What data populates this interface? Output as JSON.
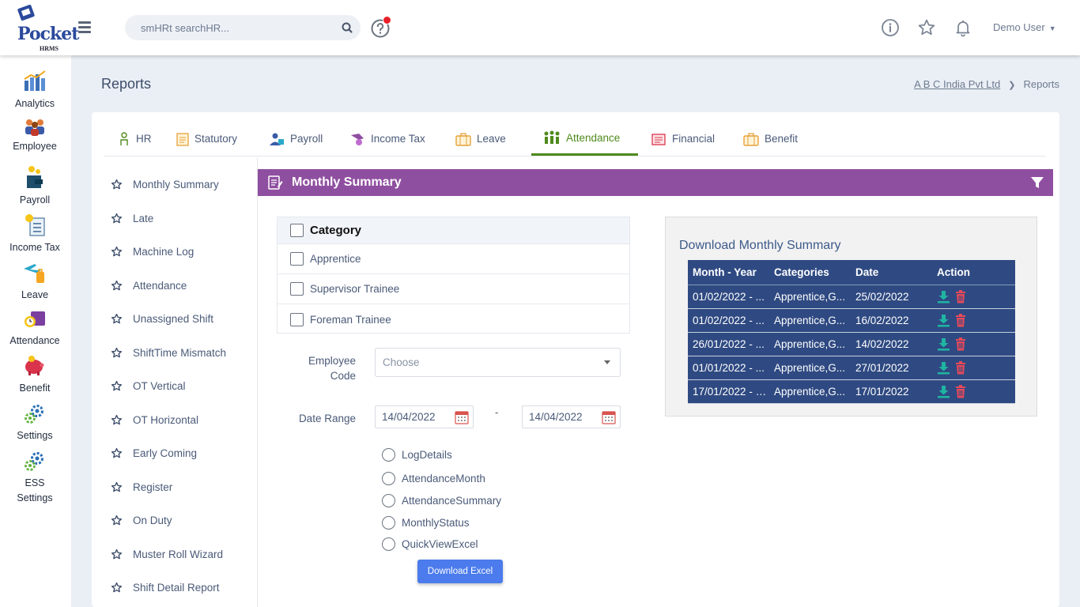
{
  "app": {
    "logo_text": "Pocket",
    "logo_sub": "HRMS"
  },
  "search": {
    "placeholder": "smHRt searchHR..."
  },
  "user": {
    "name": "Demo User"
  },
  "sidebar": {
    "items": [
      {
        "label": "Analytics",
        "icon": "analytics-icon"
      },
      {
        "label": "Employee",
        "icon": "employee-icon"
      },
      {
        "label": "Payroll",
        "icon": "payroll-icon"
      },
      {
        "label": "Income Tax",
        "icon": "income-tax-icon"
      },
      {
        "label": "Leave",
        "icon": "leave-icon"
      },
      {
        "label": "Attendance",
        "icon": "attendance-icon"
      },
      {
        "label": "Benefit",
        "icon": "benefit-icon"
      },
      {
        "label": "Settings",
        "icon": "settings-icon"
      },
      {
        "label": "ESS Settings",
        "icon": "ess-settings-icon"
      }
    ]
  },
  "page": {
    "title": "Reports",
    "breadcrumb": {
      "company": "A B C India Pvt Ltd",
      "current": "Reports"
    }
  },
  "tabs": [
    {
      "label": "HR",
      "icon": "hr-icon"
    },
    {
      "label": "Statutory",
      "icon": "statutory-icon"
    },
    {
      "label": "Payroll",
      "icon": "payroll-icon"
    },
    {
      "label": "Income Tax",
      "icon": "income-tax-icon"
    },
    {
      "label": "Leave",
      "icon": "leave-icon"
    },
    {
      "label": "Attendance",
      "icon": "attendance-icon",
      "active": true
    },
    {
      "label": "Financial",
      "icon": "financial-icon"
    },
    {
      "label": "Benefit",
      "icon": "benefit-icon"
    }
  ],
  "reports": [
    "Monthly Summary",
    "Late",
    "Machine Log",
    "Attendance",
    "Unassigned Shift",
    "ShiftTime Mismatch",
    "OT Vertical",
    "OT Horizontal",
    "Early Coming",
    "Register",
    "On Duty",
    "Muster Roll Wizard",
    "Shift Detail Report"
  ],
  "section": {
    "title": "Monthly Summary"
  },
  "category": {
    "title": "Category",
    "options": [
      "Apprentice",
      "Supervisor Trainee",
      "Foreman Trainee"
    ]
  },
  "form": {
    "employee_code_label": "Employee Code",
    "employee_code_placeholder": "Choose",
    "date_range_label": "Date Range",
    "date_from": "14/04/2022",
    "date_separator": "-",
    "date_to": "14/04/2022",
    "options": [
      "LogDetails",
      "AttendanceMonth",
      "AttendanceSummary",
      "MonthlyStatus",
      "QuickViewExcel"
    ],
    "download_label": "Download Excel"
  },
  "download_panel": {
    "title": "Download Monthly Summary",
    "columns": [
      "Month - Year",
      "Categories",
      "Date",
      "Action"
    ],
    "rows": [
      {
        "month_year": "01/02/2022 - ...",
        "categories": "Apprentice,G...",
        "date": "25/02/2022"
      },
      {
        "month_year": "01/02/2022 - ...",
        "categories": "Apprentice,G...",
        "date": "16/02/2022"
      },
      {
        "month_year": "26/01/2022 - ...",
        "categories": "Apprentice,G...",
        "date": "14/02/2022"
      },
      {
        "month_year": "01/01/2022 - ...",
        "categories": "Apprentice,G...",
        "date": "27/01/2022"
      },
      {
        "month_year": "17/01/2022 - 1...",
        "categories": "Apprentice,G...",
        "date": "17/01/2022"
      }
    ]
  },
  "colors": {
    "accent_purple": "#8f4fa0",
    "tab_active_green": "#4f8a1c",
    "table_navy": "#2f4a82",
    "button_blue": "#4b7bec",
    "download_teal": "#1fb5a2",
    "delete_red": "#e8495a"
  }
}
